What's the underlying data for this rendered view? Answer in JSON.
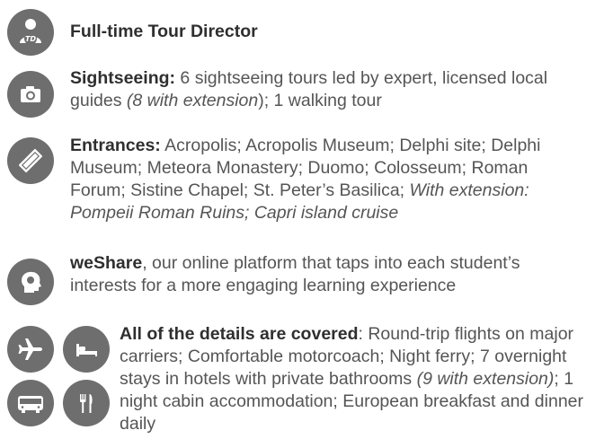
{
  "items": [
    {
      "icon": "tour-director-icon",
      "title": "Full-time Tour Director"
    },
    {
      "icon": "camera-icon",
      "title": "Sightseeing:",
      "text1": " 6 sightseeing tours led by expert, licensed local guides ",
      "italic1": "(8 with extension",
      "text2": "); 1 walking tour"
    },
    {
      "icon": "ticket-icon",
      "title": "Entrances:",
      "text1": " Acropolis; Acropolis Museum; Delphi site; Delphi Museum; Meteora Monastery; Duomo; Colosseum; Roman Forum; Sistine Chapel; St. Peter’s Basilica; ",
      "italic1": "With extension: Pompeii Roman Ruins; Capri island cruise"
    },
    {
      "icon": "weshare-head-icon",
      "title": "weShare",
      "text1": ", our online platform that taps into each student’s interests for a more engaging learning experience"
    },
    {
      "icons": [
        "airplane-icon",
        "hotel-bed-icon",
        "bus-icon",
        "dining-icon"
      ],
      "title": "All of the details are covered",
      "text1": ": Round-trip flights on major carriers; Comfortable motorcoach; Night ferry; 7 overnight stays in hotels with private bathrooms ",
      "italic1": "(9 with extension)",
      "text2": "; 1 night cabin accommodation; European breakfast and dinner daily"
    }
  ],
  "colors": {
    "icon_bg": "#6e6e6e",
    "title": "#2f2f2f",
    "body": "#555555"
  }
}
